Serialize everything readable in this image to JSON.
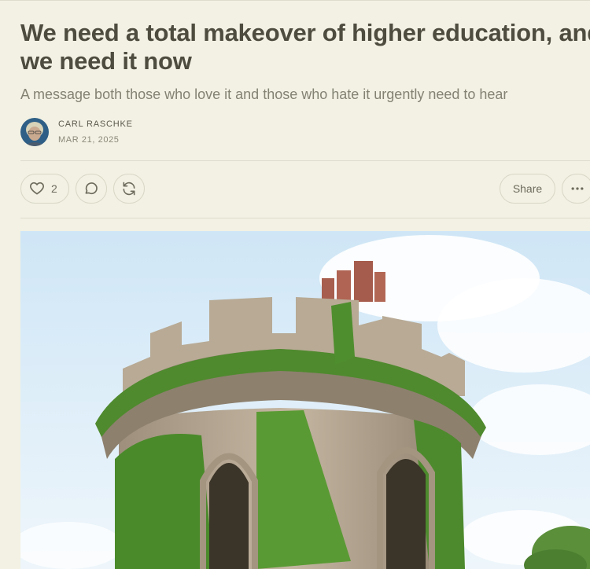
{
  "article": {
    "title": "We need a total makeover of higher education, and we need it now",
    "subtitle": "A message both those who love it and those who hate it urgently need to hear",
    "author": "CARL RASCHKE",
    "date": "MAR 21, 2025"
  },
  "actions": {
    "like_count": "2",
    "share_label": "Share"
  },
  "icons": {
    "like": "heart-icon",
    "comment": "comment-bubble-icon",
    "restack": "restack-icon",
    "more": "ellipsis-icon"
  },
  "colors": {
    "background": "#f2f1e3",
    "title": "#4d4c3e",
    "subtitle": "#838273",
    "border": "#d8d7c6"
  }
}
